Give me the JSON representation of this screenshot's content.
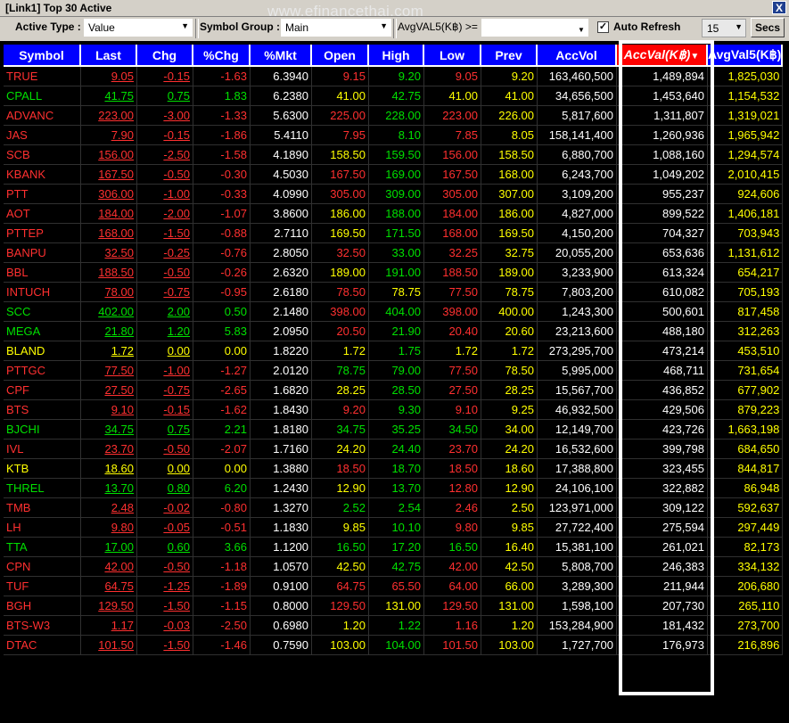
{
  "window": {
    "title": "[Link1] Top 30 Active",
    "close_glyph": "X",
    "watermark": "www.efinancethai.com"
  },
  "toolbar": {
    "active_type_label": "Active Type :",
    "active_type_value": "Value",
    "symbol_group_label": "Symbol Group :",
    "symbol_group_value": "Main",
    "filter_label": "AvgVAL5(K฿) >=",
    "auto_refresh_label": "Auto Refresh",
    "auto_refresh_checked": true,
    "interval_value": "15",
    "secs_label": "Secs"
  },
  "colors": {
    "header_bg": "#0000ff",
    "sorted_header_bg": "#ff0000",
    "up": "#00e000",
    "down": "#ff3030",
    "unchanged": "#ffff00"
  },
  "table": {
    "columns": [
      "Symbol",
      "Last",
      "Chg",
      "%Chg",
      "%Mkt",
      "Open",
      "High",
      "Low",
      "Prev",
      "AccVol",
      "AccVal(K฿)",
      "AvgVal5(K฿)"
    ],
    "sorted_column": 10,
    "rows": [
      {
        "sym": "TRUE",
        "last": "9.05",
        "chg": "-0.15",
        "pchg": "-1.63",
        "mkt": "6.3940",
        "open": "9.15",
        "high": "9.20",
        "low": "9.05",
        "prev": "9.20",
        "vol": "163,460,500",
        "val": "1,489,894",
        "avg": "1,825,030",
        "dir": "d",
        "od": "d",
        "hd": "u",
        "ld": "d"
      },
      {
        "sym": "CPALL",
        "last": "41.75",
        "chg": "0.75",
        "pchg": "1.83",
        "mkt": "6.2380",
        "open": "41.00",
        "high": "42.75",
        "low": "41.00",
        "prev": "41.00",
        "vol": "34,656,500",
        "val": "1,453,640",
        "avg": "1,154,532",
        "dir": "u",
        "od": "n",
        "hd": "u",
        "ld": "n"
      },
      {
        "sym": "ADVANC",
        "last": "223.00",
        "chg": "-3.00",
        "pchg": "-1.33",
        "mkt": "5.6300",
        "open": "225.00",
        "high": "228.00",
        "low": "223.00",
        "prev": "226.00",
        "vol": "5,817,600",
        "val": "1,311,807",
        "avg": "1,319,021",
        "dir": "d",
        "od": "d",
        "hd": "u",
        "ld": "d"
      },
      {
        "sym": "JAS",
        "last": "7.90",
        "chg": "-0.15",
        "pchg": "-1.86",
        "mkt": "5.4110",
        "open": "7.95",
        "high": "8.10",
        "low": "7.85",
        "prev": "8.05",
        "vol": "158,141,400",
        "val": "1,260,936",
        "avg": "1,965,942",
        "dir": "d",
        "od": "d",
        "hd": "u",
        "ld": "d"
      },
      {
        "sym": "SCB",
        "last": "156.00",
        "chg": "-2.50",
        "pchg": "-1.58",
        "mkt": "4.1890",
        "open": "158.50",
        "high": "159.50",
        "low": "156.00",
        "prev": "158.50",
        "vol": "6,880,700",
        "val": "1,088,160",
        "avg": "1,294,574",
        "dir": "d",
        "od": "n",
        "hd": "u",
        "ld": "d"
      },
      {
        "sym": "KBANK",
        "last": "167.50",
        "chg": "-0.50",
        "pchg": "-0.30",
        "mkt": "4.5030",
        "open": "167.50",
        "high": "169.00",
        "low": "167.50",
        "prev": "168.00",
        "vol": "6,243,700",
        "val": "1,049,202",
        "avg": "2,010,415",
        "dir": "d",
        "od": "d",
        "hd": "u",
        "ld": "d"
      },
      {
        "sym": "PTT",
        "last": "306.00",
        "chg": "-1.00",
        "pchg": "-0.33",
        "mkt": "4.0990",
        "open": "305.00",
        "high": "309.00",
        "low": "305.00",
        "prev": "307.00",
        "vol": "3,109,200",
        "val": "955,237",
        "avg": "924,606",
        "dir": "d",
        "od": "d",
        "hd": "u",
        "ld": "d"
      },
      {
        "sym": "AOT",
        "last": "184.00",
        "chg": "-2.00",
        "pchg": "-1.07",
        "mkt": "3.8600",
        "open": "186.00",
        "high": "188.00",
        "low": "184.00",
        "prev": "186.00",
        "vol": "4,827,000",
        "val": "899,522",
        "avg": "1,406,181",
        "dir": "d",
        "od": "n",
        "hd": "u",
        "ld": "d"
      },
      {
        "sym": "PTTEP",
        "last": "168.00",
        "chg": "-1.50",
        "pchg": "-0.88",
        "mkt": "2.7110",
        "open": "169.50",
        "high": "171.50",
        "low": "168.00",
        "prev": "169.50",
        "vol": "4,150,200",
        "val": "704,327",
        "avg": "703,943",
        "dir": "d",
        "od": "n",
        "hd": "u",
        "ld": "d"
      },
      {
        "sym": "BANPU",
        "last": "32.50",
        "chg": "-0.25",
        "pchg": "-0.76",
        "mkt": "2.8050",
        "open": "32.50",
        "high": "33.00",
        "low": "32.25",
        "prev": "32.75",
        "vol": "20,055,200",
        "val": "653,636",
        "avg": "1,131,612",
        "dir": "d",
        "od": "d",
        "hd": "u",
        "ld": "d"
      },
      {
        "sym": "BBL",
        "last": "188.50",
        "chg": "-0.50",
        "pchg": "-0.26",
        "mkt": "2.6320",
        "open": "189.00",
        "high": "191.00",
        "low": "188.50",
        "prev": "189.00",
        "vol": "3,233,900",
        "val": "613,324",
        "avg": "654,217",
        "dir": "d",
        "od": "n",
        "hd": "u",
        "ld": "d"
      },
      {
        "sym": "INTUCH",
        "last": "78.00",
        "chg": "-0.75",
        "pchg": "-0.95",
        "mkt": "2.6180",
        "open": "78.50",
        "high": "78.75",
        "low": "77.50",
        "prev": "78.75",
        "vol": "7,803,200",
        "val": "610,082",
        "avg": "705,193",
        "dir": "d",
        "od": "d",
        "hd": "n",
        "ld": "d"
      },
      {
        "sym": "SCC",
        "last": "402.00",
        "chg": "2.00",
        "pchg": "0.50",
        "mkt": "2.1480",
        "open": "398.00",
        "high": "404.00",
        "low": "398.00",
        "prev": "400.00",
        "vol": "1,243,300",
        "val": "500,601",
        "avg": "817,458",
        "dir": "u",
        "od": "d",
        "hd": "u",
        "ld": "d"
      },
      {
        "sym": "MEGA",
        "last": "21.80",
        "chg": "1.20",
        "pchg": "5.83",
        "mkt": "2.0950",
        "open": "20.50",
        "high": "21.90",
        "low": "20.40",
        "prev": "20.60",
        "vol": "23,213,600",
        "val": "488,180",
        "avg": "312,263",
        "dir": "u",
        "od": "d",
        "hd": "u",
        "ld": "d"
      },
      {
        "sym": "BLAND",
        "last": "1.72",
        "chg": "0.00",
        "pchg": "0.00",
        "mkt": "1.8220",
        "open": "1.72",
        "high": "1.75",
        "low": "1.72",
        "prev": "1.72",
        "vol": "273,295,700",
        "val": "473,214",
        "avg": "453,510",
        "dir": "n",
        "od": "n",
        "hd": "u",
        "ld": "n"
      },
      {
        "sym": "PTTGC",
        "last": "77.50",
        "chg": "-1.00",
        "pchg": "-1.27",
        "mkt": "2.0120",
        "open": "78.75",
        "high": "79.00",
        "low": "77.50",
        "prev": "78.50",
        "vol": "5,995,000",
        "val": "468,711",
        "avg": "731,654",
        "dir": "d",
        "od": "u",
        "hd": "u",
        "ld": "d"
      },
      {
        "sym": "CPF",
        "last": "27.50",
        "chg": "-0.75",
        "pchg": "-2.65",
        "mkt": "1.6820",
        "open": "28.25",
        "high": "28.50",
        "low": "27.50",
        "prev": "28.25",
        "vol": "15,567,700",
        "val": "436,852",
        "avg": "677,902",
        "dir": "d",
        "od": "n",
        "hd": "u",
        "ld": "d"
      },
      {
        "sym": "BTS",
        "last": "9.10",
        "chg": "-0.15",
        "pchg": "-1.62",
        "mkt": "1.8430",
        "open": "9.20",
        "high": "9.30",
        "low": "9.10",
        "prev": "9.25",
        "vol": "46,932,500",
        "val": "429,506",
        "avg": "879,223",
        "dir": "d",
        "od": "d",
        "hd": "u",
        "ld": "d"
      },
      {
        "sym": "BJCHI",
        "last": "34.75",
        "chg": "0.75",
        "pchg": "2.21",
        "mkt": "1.8180",
        "open": "34.75",
        "high": "35.25",
        "low": "34.50",
        "prev": "34.00",
        "vol": "12,149,700",
        "val": "423,726",
        "avg": "1,663,198",
        "dir": "u",
        "od": "u",
        "hd": "u",
        "ld": "u"
      },
      {
        "sym": "IVL",
        "last": "23.70",
        "chg": "-0.50",
        "pchg": "-2.07",
        "mkt": "1.7160",
        "open": "24.20",
        "high": "24.40",
        "low": "23.70",
        "prev": "24.20",
        "vol": "16,532,600",
        "val": "399,798",
        "avg": "684,650",
        "dir": "d",
        "od": "n",
        "hd": "u",
        "ld": "d"
      },
      {
        "sym": "KTB",
        "last": "18.60",
        "chg": "0.00",
        "pchg": "0.00",
        "mkt": "1.3880",
        "open": "18.50",
        "high": "18.70",
        "low": "18.50",
        "prev": "18.60",
        "vol": "17,388,800",
        "val": "323,455",
        "avg": "844,817",
        "dir": "n",
        "od": "d",
        "hd": "u",
        "ld": "d"
      },
      {
        "sym": "THREL",
        "last": "13.70",
        "chg": "0.80",
        "pchg": "6.20",
        "mkt": "1.2430",
        "open": "12.90",
        "high": "13.70",
        "low": "12.80",
        "prev": "12.90",
        "vol": "24,106,100",
        "val": "322,882",
        "avg": "86,948",
        "dir": "u",
        "od": "n",
        "hd": "u",
        "ld": "d"
      },
      {
        "sym": "TMB",
        "last": "2.48",
        "chg": "-0.02",
        "pchg": "-0.80",
        "mkt": "1.3270",
        "open": "2.52",
        "high": "2.54",
        "low": "2.46",
        "prev": "2.50",
        "vol": "123,971,000",
        "val": "309,122",
        "avg": "592,637",
        "dir": "d",
        "od": "u",
        "hd": "u",
        "ld": "d"
      },
      {
        "sym": "LH",
        "last": "9.80",
        "chg": "-0.05",
        "pchg": "-0.51",
        "mkt": "1.1830",
        "open": "9.85",
        "high": "10.10",
        "low": "9.80",
        "prev": "9.85",
        "vol": "27,722,400",
        "val": "275,594",
        "avg": "297,449",
        "dir": "d",
        "od": "n",
        "hd": "u",
        "ld": "d"
      },
      {
        "sym": "TTA",
        "last": "17.00",
        "chg": "0.60",
        "pchg": "3.66",
        "mkt": "1.1200",
        "open": "16.50",
        "high": "17.20",
        "low": "16.50",
        "prev": "16.40",
        "vol": "15,381,100",
        "val": "261,021",
        "avg": "82,173",
        "dir": "u",
        "od": "u",
        "hd": "u",
        "ld": "u"
      },
      {
        "sym": "CPN",
        "last": "42.00",
        "chg": "-0.50",
        "pchg": "-1.18",
        "mkt": "1.0570",
        "open": "42.50",
        "high": "42.75",
        "low": "42.00",
        "prev": "42.50",
        "vol": "5,808,700",
        "val": "246,383",
        "avg": "334,132",
        "dir": "d",
        "od": "n",
        "hd": "u",
        "ld": "d"
      },
      {
        "sym": "TUF",
        "last": "64.75",
        "chg": "-1.25",
        "pchg": "-1.89",
        "mkt": "0.9100",
        "open": "64.75",
        "high": "65.50",
        "low": "64.00",
        "prev": "66.00",
        "vol": "3,289,300",
        "val": "211,944",
        "avg": "206,680",
        "dir": "d",
        "od": "d",
        "hd": "d",
        "ld": "d"
      },
      {
        "sym": "BGH",
        "last": "129.50",
        "chg": "-1.50",
        "pchg": "-1.15",
        "mkt": "0.8000",
        "open": "129.50",
        "high": "131.00",
        "low": "129.50",
        "prev": "131.00",
        "vol": "1,598,100",
        "val": "207,730",
        "avg": "265,110",
        "dir": "d",
        "od": "d",
        "hd": "n",
        "ld": "d"
      },
      {
        "sym": "BTS-W3",
        "last": "1.17",
        "chg": "-0.03",
        "pchg": "-2.50",
        "mkt": "0.6980",
        "open": "1.20",
        "high": "1.22",
        "low": "1.16",
        "prev": "1.20",
        "vol": "153,284,900",
        "val": "181,432",
        "avg": "273,700",
        "dir": "d",
        "od": "n",
        "hd": "u",
        "ld": "d"
      },
      {
        "sym": "DTAC",
        "last": "101.50",
        "chg": "-1.50",
        "pchg": "-1.46",
        "mkt": "0.7590",
        "open": "103.00",
        "high": "104.00",
        "low": "101.50",
        "prev": "103.00",
        "vol": "1,727,700",
        "val": "176,973",
        "avg": "216,896",
        "dir": "d",
        "od": "n",
        "hd": "u",
        "ld": "d"
      }
    ]
  }
}
